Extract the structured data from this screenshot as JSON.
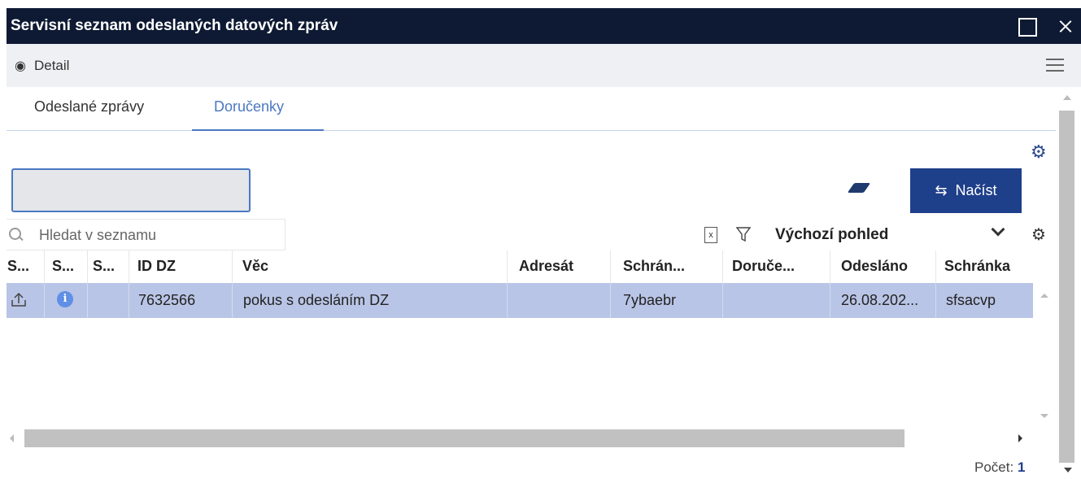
{
  "window": {
    "title": "Servisní seznam odeslaných datových zpráv"
  },
  "toolbar": {
    "detail_label": "Detail",
    "detail_icon": "eye-icon",
    "menu_icon": "hamburger-icon"
  },
  "tabs": [
    {
      "label": "Odeslané zprávy",
      "active": false
    },
    {
      "label": "Doručenky",
      "active": true
    }
  ],
  "filter": {
    "value": ""
  },
  "actions": {
    "clear_icon": "eraser-icon",
    "load_label": "Načíst",
    "load_icon": "reload-icon",
    "settings_icon": "gear-icon"
  },
  "search": {
    "placeholder": "Hledat v seznamu",
    "value": ""
  },
  "view": {
    "export_icon": "excel-export-icon",
    "filter_icon": "funnel-icon",
    "selected": "Výchozí pohled",
    "settings_icon": "gear-icon"
  },
  "grid": {
    "columns": [
      "S...",
      "S...",
      "S...",
      "ID DZ",
      "Věc",
      "Adresát",
      "Schrán...",
      "Doruče...",
      "Odesláno",
      "Schránka"
    ],
    "rows": [
      {
        "status_icon": "upload-icon",
        "info_icon": "info-icon",
        "s3": "",
        "id_dz": "7632566",
        "vec": "pokus s odesláním DZ",
        "adresat": "",
        "schranka_short": "7ybaebr",
        "doruceno": "",
        "odeslano": "26.08.202...",
        "schranka": "sfsacvp"
      }
    ]
  },
  "footer": {
    "count_label": "Počet:",
    "count_value": "1"
  },
  "colors": {
    "titlebar": "#0e1a33",
    "accent": "#1e3f8a",
    "tab_active": "#4a78c2",
    "selected_row": "#b9c5e6"
  }
}
